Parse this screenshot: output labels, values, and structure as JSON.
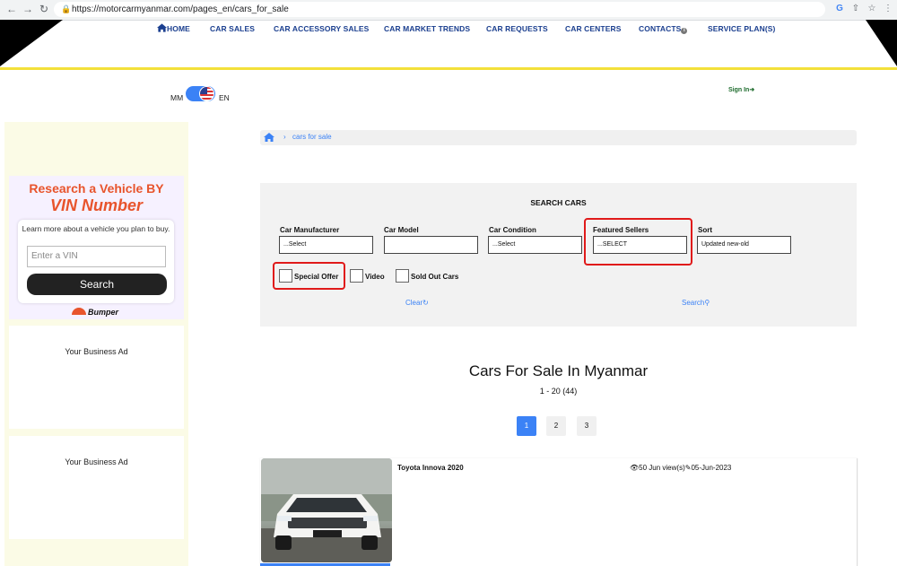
{
  "browser": {
    "url": "https://motorcarmyanmar.com/pages_en/cars_for_sale"
  },
  "nav": {
    "items": [
      {
        "label": "HOME"
      },
      {
        "label": "CAR SALES"
      },
      {
        "label": "CAR ACCESSORY SALES"
      },
      {
        "label": "CAR MARKET TRENDS"
      },
      {
        "label": "CAR REQUESTS"
      },
      {
        "label": "CAR CENTERS"
      },
      {
        "label": "CONTACTS"
      },
      {
        "label": "SERVICE PLAN(S)"
      }
    ]
  },
  "language": {
    "left": "MM",
    "right": "EN"
  },
  "auth": {
    "signin": "Sign In"
  },
  "sidebar": {
    "vin_ad": {
      "title_line1": "Research a Vehicle BY",
      "title_line2": "VIN Number",
      "description": "Learn more about a vehicle you plan to buy.",
      "input_placeholder": "Enter a VIN",
      "button": "Search",
      "brand": "Bumper"
    },
    "ads": [
      "Your Business Ad",
      "Your Business Ad"
    ]
  },
  "breadcrumb": {
    "current": "cars for sale"
  },
  "search": {
    "title": "SEARCH CARS",
    "filters": [
      {
        "label": "Car Manufacturer",
        "value": "...Select"
      },
      {
        "label": "Car Model",
        "value": ""
      },
      {
        "label": "Car Condition",
        "value": "...Select"
      },
      {
        "label": "Featured Sellers",
        "value": "...SELECT"
      },
      {
        "label": "Sort",
        "value": "Updated new-old"
      }
    ],
    "checkboxes": [
      {
        "label": "Special Offer",
        "checked": false
      },
      {
        "label": "Video",
        "checked": false
      },
      {
        "label": "Sold Out Cars",
        "checked": false
      }
    ],
    "clear": "Clear",
    "search": "Search"
  },
  "results": {
    "title": "Cars For Sale In Myanmar",
    "count": "1 - 20 (44)"
  },
  "pagination": {
    "pages": [
      "1",
      "2",
      "3"
    ],
    "active": "1"
  },
  "listings": [
    {
      "title": "Toyota Innova 2020",
      "views": "50 Jun view(s)",
      "date": "05-Jun-2023"
    }
  ],
  "colors": {
    "nav": "#1b3f8f",
    "accent": "#3b82f6",
    "highlight": "#e01a1a",
    "header_line": "#f3e03a"
  }
}
